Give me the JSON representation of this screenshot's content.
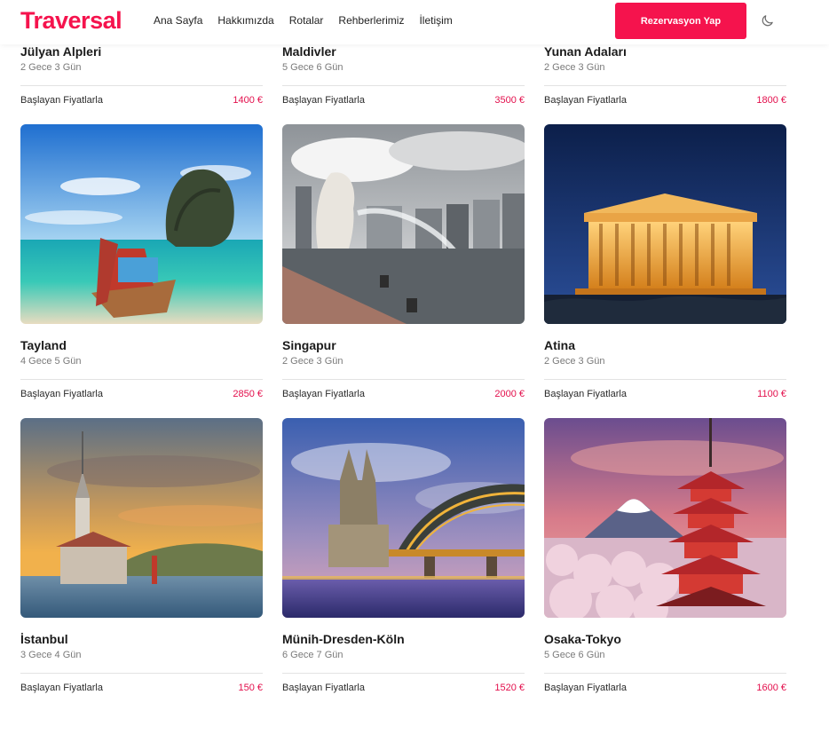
{
  "header": {
    "logo": "Traversal",
    "nav": [
      "Ana Sayfa",
      "Hakkımızda",
      "Rotalar",
      "Rehberlerimiz",
      "İletişim"
    ],
    "cta_label": "Rezervasyon Yap",
    "theme_icon": "moon-icon"
  },
  "price_label": "Başlayan Fiyatlarla",
  "tours": [
    {
      "name": "Jülyan Alpleri",
      "duration": "2 Gece 3 Gün",
      "price": "1400 €"
    },
    {
      "name": "Maldivler",
      "duration": "5 Gece 6 Gün",
      "price": "3500 €"
    },
    {
      "name": "Yunan Adaları",
      "duration": "2 Gece 3 Gün",
      "price": "1800 €"
    },
    {
      "name": "Tayland",
      "duration": "4 Gece 5 Gün",
      "price": "2850 €"
    },
    {
      "name": "Singapur",
      "duration": "2 Gece 3 Gün",
      "price": "2000 €"
    },
    {
      "name": "Atina",
      "duration": "2 Gece 3 Gün",
      "price": "1100 €"
    },
    {
      "name": "İstanbul",
      "duration": "3 Gece 4 Gün",
      "price": "150 €"
    },
    {
      "name": "Münih-Dresden-Köln",
      "duration": "6 Gece 7 Gün",
      "price": "1520 €"
    },
    {
      "name": "Osaka-Tokyo",
      "duration": "5 Gece 6 Gün",
      "price": "1600 €"
    }
  ],
  "colors": {
    "accent": "#f5134d",
    "price": "#e30f4c"
  }
}
